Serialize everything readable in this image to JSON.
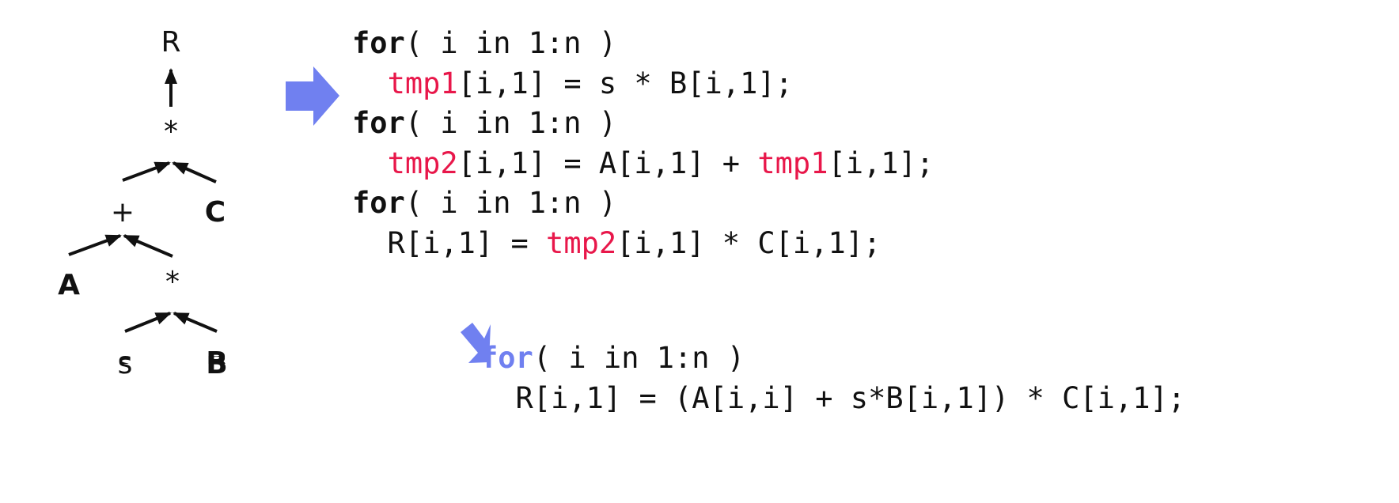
{
  "tree": {
    "root": "R",
    "mul_top": "*",
    "plus": "+",
    "c": "C",
    "a": "A",
    "mul_inner": "*",
    "s": "s",
    "b": "B"
  },
  "code_block_1": {
    "lines": [
      [
        {
          "t": "for",
          "k": "kw"
        },
        {
          "t": "( i in 1:n )",
          "k": ""
        }
      ],
      [
        {
          "t": "  ",
          "k": ""
        },
        {
          "t": "tmp1",
          "k": "tmp"
        },
        {
          "t": "[i,1] = s * B[i,1];",
          "k": ""
        }
      ],
      [
        {
          "t": "for",
          "k": "kw"
        },
        {
          "t": "( i in 1:n )",
          "k": ""
        }
      ],
      [
        {
          "t": "  ",
          "k": ""
        },
        {
          "t": "tmp2",
          "k": "tmp"
        },
        {
          "t": "[i,1] = A[i,1] + ",
          "k": ""
        },
        {
          "t": "tmp1",
          "k": "tmp"
        },
        {
          "t": "[i,1];",
          "k": ""
        }
      ],
      [
        {
          "t": "for",
          "k": "kw"
        },
        {
          "t": "( i in 1:n )",
          "k": ""
        }
      ],
      [
        {
          "t": "  R[i,1] = ",
          "k": ""
        },
        {
          "t": "tmp2",
          "k": "tmp"
        },
        {
          "t": "[i,1] * C[i,1];",
          "k": ""
        }
      ]
    ]
  },
  "code_block_2": {
    "lines": [
      [
        {
          "t": "for",
          "k": "kw-blue"
        },
        {
          "t": "( i in 1:n )",
          "k": ""
        }
      ],
      [
        {
          "t": "  R[i,1] = (A[i,i] + s*B[i,1]) * C[i,1];",
          "k": ""
        }
      ]
    ]
  },
  "colors": {
    "arrow": "#7080F0",
    "temp": "#E8174A",
    "text": "#111111"
  }
}
